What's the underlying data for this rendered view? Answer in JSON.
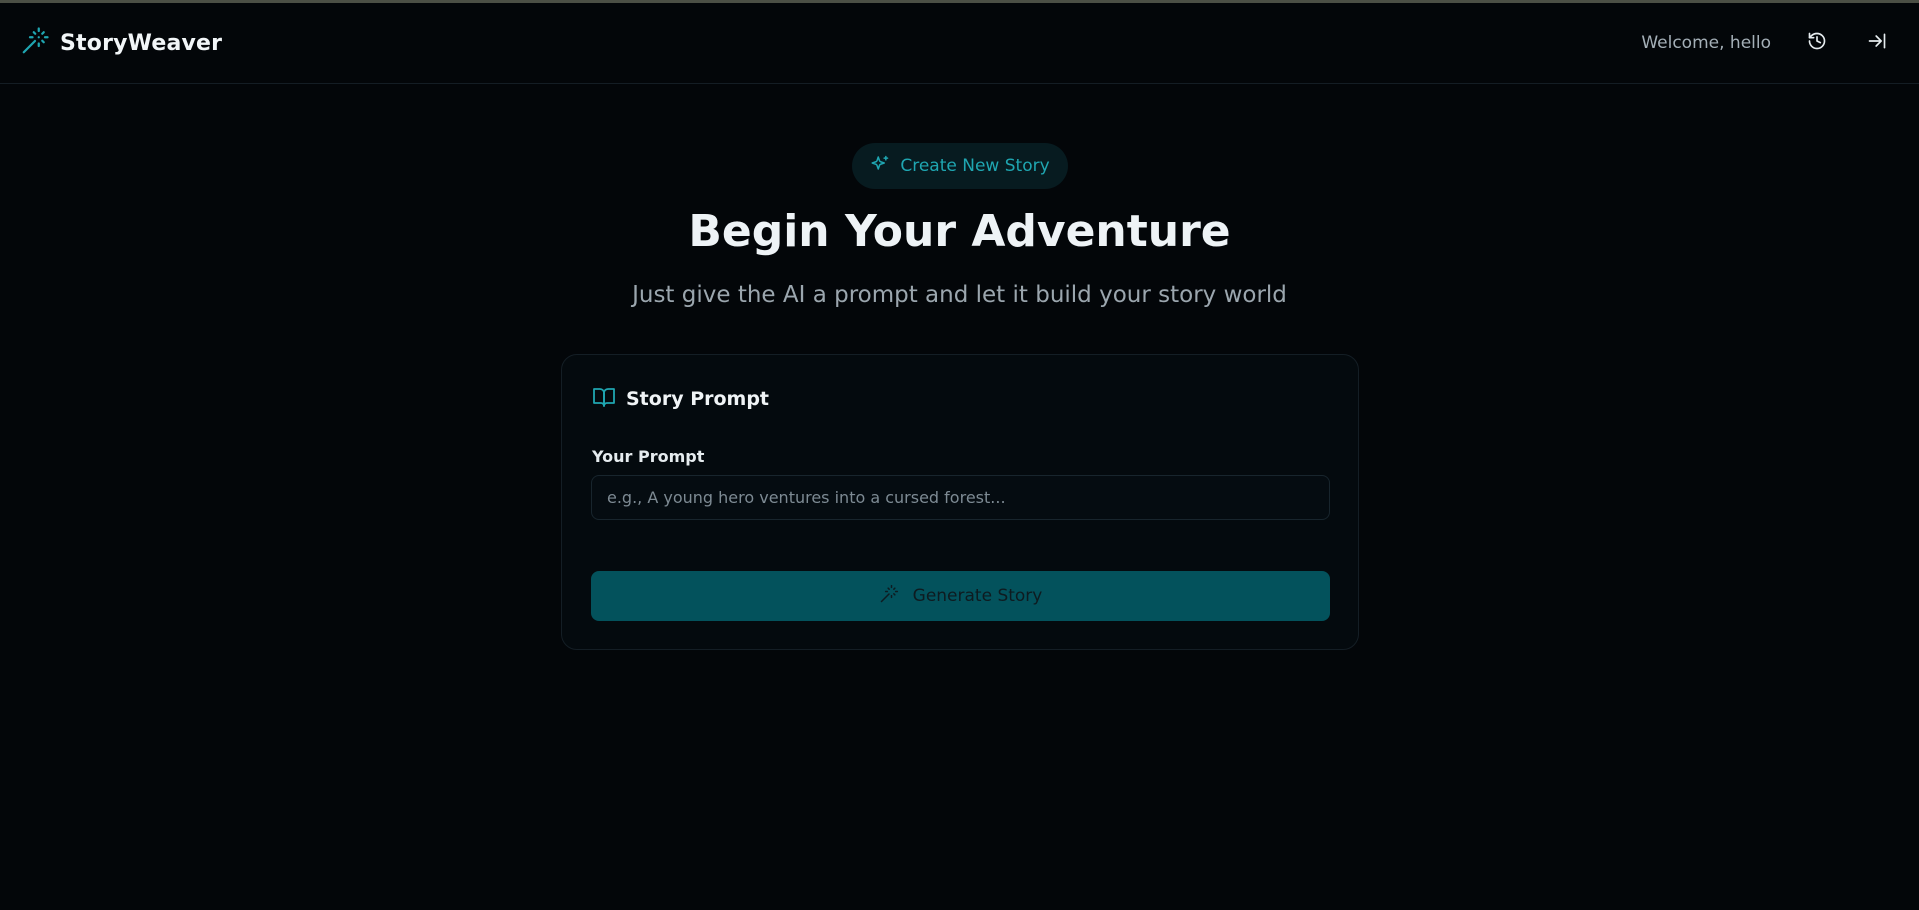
{
  "header": {
    "brand": "StoryWeaver",
    "welcome": "Welcome, hello",
    "icons": {
      "logo": "magic-wand-icon",
      "history": "history-icon",
      "logout": "logout-icon"
    }
  },
  "hero": {
    "badge": "Create New Story",
    "title": "Begin Your Adventure",
    "subtitle": "Just give the AI a prompt and let it build your story world"
  },
  "card": {
    "title": "Story Prompt",
    "field_label": "Your Prompt",
    "prompt_value": "",
    "prompt_placeholder": "e.g., A young hero ventures into a cursed forest...",
    "generate_label": "Generate Story"
  },
  "colors": {
    "background": "#030609",
    "accent": "#1fa6b1",
    "button": "#03525c"
  }
}
